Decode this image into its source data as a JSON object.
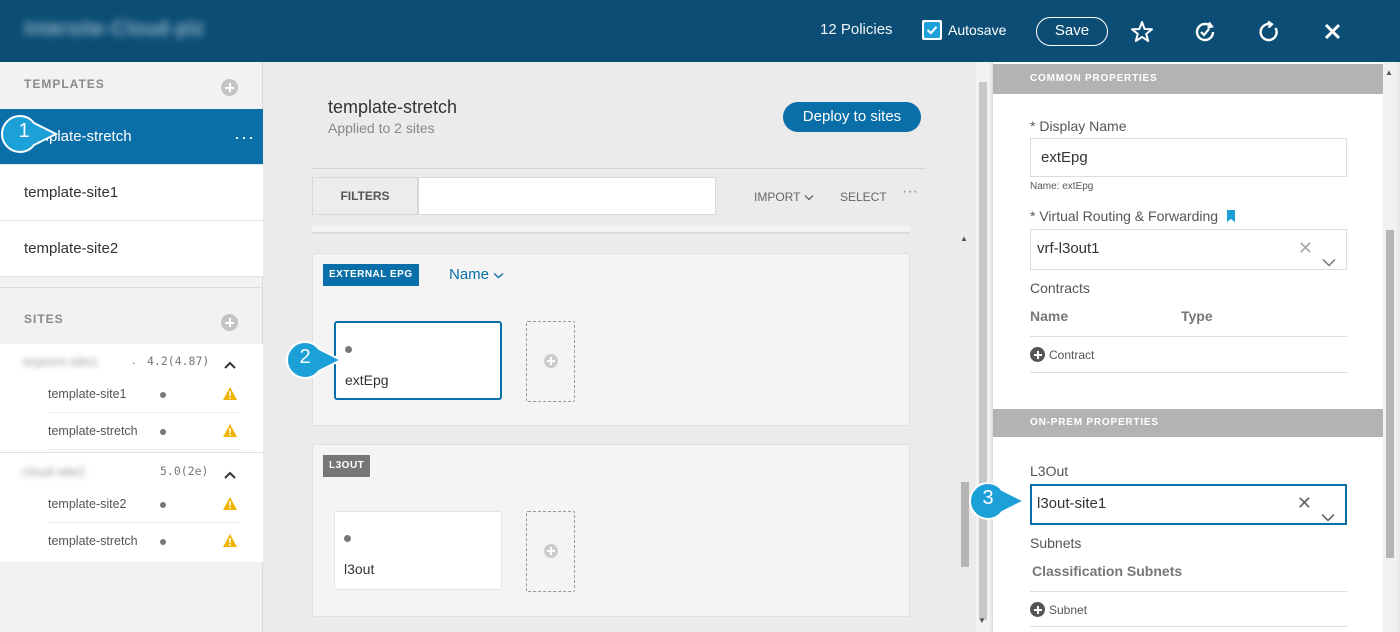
{
  "header": {
    "app_title": "Intersite-Cloud-plz",
    "policies": "12 Policies",
    "autosave_label": "Autosave",
    "save_label": "Save"
  },
  "sidebar": {
    "templates_header": "TEMPLATES",
    "templates": [
      {
        "label": "template-stretch"
      },
      {
        "label": "template-site1"
      },
      {
        "label": "template-site2"
      }
    ],
    "more_label": "···",
    "sites_header": "SITES",
    "sites": [
      {
        "name": "onprem-site1",
        "version": "4.2(4.87)",
        "templates": [
          "template-site1",
          "template-stretch"
        ]
      },
      {
        "name": "cloud-site2",
        "version": "5.0(2e)",
        "templates": [
          "template-site2",
          "template-stretch"
        ]
      }
    ]
  },
  "main": {
    "template_name": "template-stretch",
    "applied_to": "Applied to 2 sites",
    "deploy_label": "Deploy to sites",
    "filters_label": "FILTERS",
    "import_label": "IMPORT",
    "select_label": "SELECT",
    "more_label": "···",
    "sections": [
      {
        "tag": "EXTERNAL EPG",
        "sort_label": "Name",
        "cards": [
          {
            "label": "extEpg"
          }
        ]
      },
      {
        "tag": "L3OUT",
        "cards": [
          {
            "label": "l3out"
          }
        ]
      }
    ]
  },
  "properties": {
    "common_header": "COMMON PROPERTIES",
    "display_name_label": "* Display Name",
    "display_name_value": "extEpg",
    "name_hint": "Name: extEpg",
    "vrf_label": "* Virtual Routing & Forwarding",
    "vrf_value": "vrf-l3out1",
    "contracts_label": "Contracts",
    "contracts_columns": [
      "Name",
      "Type"
    ],
    "add_contract_label": "Contract",
    "onprem_header": "ON-PREM PROPERTIES",
    "l3out_label": "L3Out",
    "l3out_value": "l3out-site1",
    "subnets_label": "Subnets",
    "classification_subnets_label": "Classification Subnets",
    "add_subnet_label": "Subnet"
  },
  "callouts": [
    "1",
    "2",
    "3"
  ],
  "colors": {
    "header_bg": "#0b4d74",
    "accent": "#0a6fa8",
    "callout": "#1ba0d7",
    "warning": "#f0b400",
    "l3out_tag": "#777777"
  }
}
